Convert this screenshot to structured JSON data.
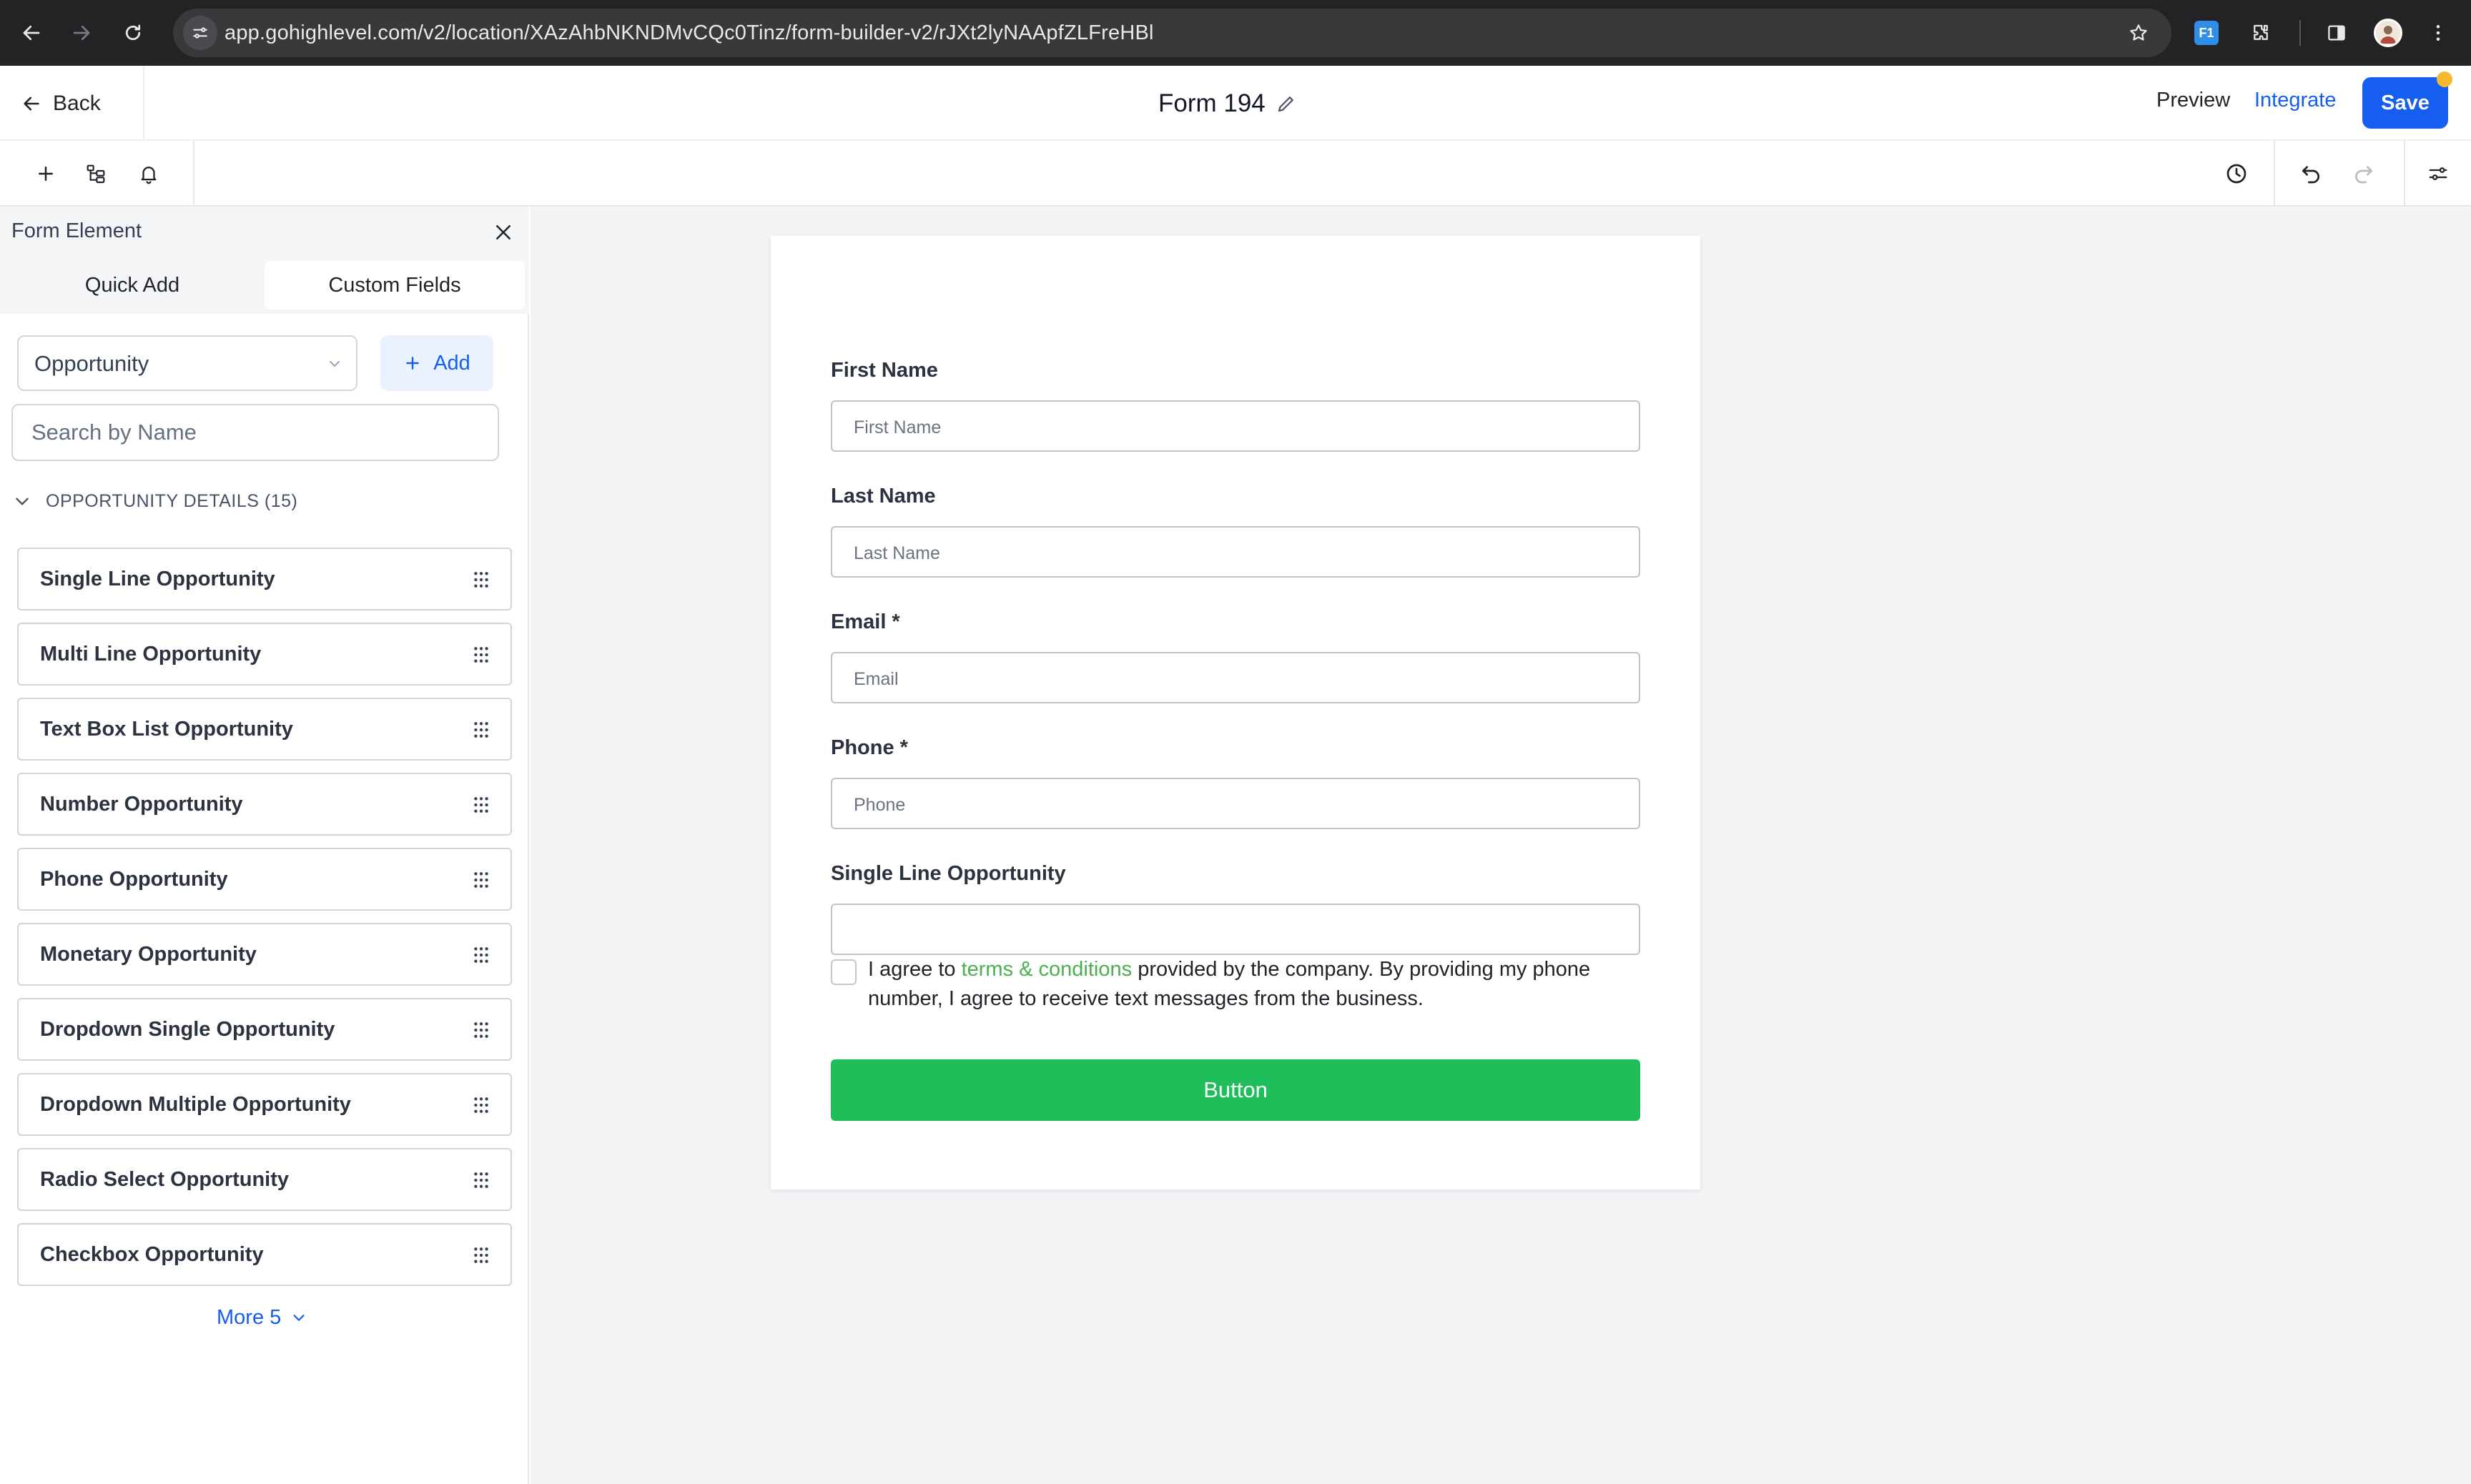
{
  "browser": {
    "url": "app.gohighlevel.com/v2/location/XAzAhbNKNDMvCQc0Tinz/form-builder-v2/rJXt2lyNAApfZLFreHBl",
    "extension_badge": "F1"
  },
  "header": {
    "back_label": "Back",
    "form_title": "Form 194",
    "preview_label": "Preview",
    "integrate_label": "Integrate",
    "save_label": "Save"
  },
  "sidebar": {
    "title": "Form Element",
    "tabs": [
      {
        "label": "Quick Add",
        "active": false
      },
      {
        "label": "Custom Fields",
        "active": true
      }
    ],
    "object_select": {
      "value": "Opportunity"
    },
    "add_label": "Add",
    "search_placeholder": "Search by Name",
    "section": {
      "label": "OPPORTUNITY DETAILS (15)",
      "expanded": true
    },
    "items": [
      {
        "label": "Single Line Opportunity"
      },
      {
        "label": "Multi Line Opportunity"
      },
      {
        "label": "Text Box List Opportunity"
      },
      {
        "label": "Number Opportunity"
      },
      {
        "label": "Phone Opportunity"
      },
      {
        "label": "Monetary Opportunity"
      },
      {
        "label": "Dropdown Single Opportunity"
      },
      {
        "label": "Dropdown Multiple Opportunity"
      },
      {
        "label": "Radio Select Opportunity"
      },
      {
        "label": "Checkbox Opportunity"
      }
    ],
    "more_label": "More 5"
  },
  "form": {
    "fields": [
      {
        "label": "First Name",
        "placeholder": "First Name"
      },
      {
        "label": "Last Name",
        "placeholder": "Last Name"
      },
      {
        "label": "Email *",
        "placeholder": "Email"
      },
      {
        "label": "Phone *",
        "placeholder": "Phone"
      },
      {
        "label": "Single Line Opportunity",
        "placeholder": ""
      }
    ],
    "consent": {
      "before": "I agree to ",
      "link": "terms & conditions",
      "after": " provided by the company. By providing my phone number, I agree to receive text messages from the business.",
      "checked": false
    },
    "submit_label": "Button"
  },
  "colors": {
    "primary": "#155eef",
    "submit_green": "#1ebf5a",
    "link_green": "#4caf50",
    "canvas_bg": "#f2f3f5"
  }
}
